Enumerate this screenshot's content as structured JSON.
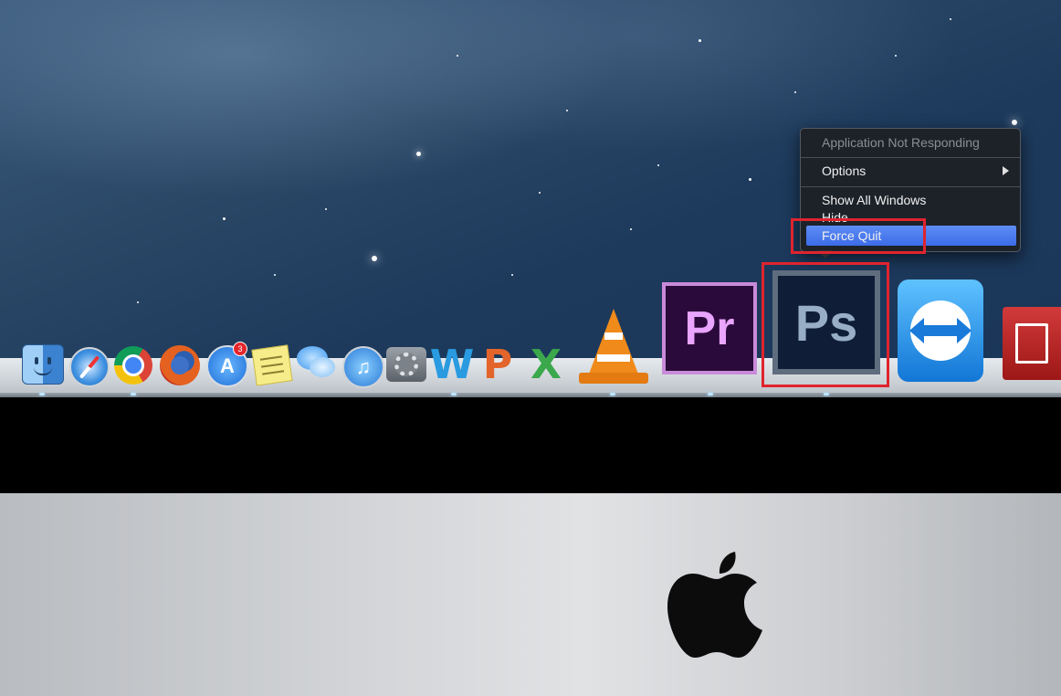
{
  "context_menu": {
    "header": "Application Not Responding",
    "items": [
      {
        "label": "Options",
        "has_submenu": true
      },
      {
        "label": "Show All Windows"
      },
      {
        "label": "Hide"
      },
      {
        "label": "Force Quit",
        "highlighted": true
      }
    ]
  },
  "dock": {
    "apps": [
      {
        "name": "Finder",
        "icon": "finder-icon"
      },
      {
        "name": "Safari",
        "icon": "safari-icon"
      },
      {
        "name": "Google Chrome",
        "icon": "chrome-icon"
      },
      {
        "name": "Firefox",
        "icon": "firefox-icon"
      },
      {
        "name": "App Store",
        "icon": "app-store-icon",
        "badge": "3"
      },
      {
        "name": "Stickies",
        "icon": "stickies-icon"
      },
      {
        "name": "Messages",
        "icon": "messages-icon"
      },
      {
        "name": "iTunes",
        "icon": "itunes-icon"
      },
      {
        "name": "System Preferences",
        "icon": "system-preferences-icon"
      },
      {
        "name": "Word",
        "icon": "word-icon",
        "glyph": "W"
      },
      {
        "name": "PowerPoint",
        "icon": "powerpoint-icon",
        "glyph": "P"
      },
      {
        "name": "Excel",
        "icon": "excel-icon",
        "glyph": "X"
      },
      {
        "name": "VLC",
        "icon": "vlc-icon"
      },
      {
        "name": "Adobe Premiere",
        "icon": "premiere-icon",
        "glyph": "Pr"
      },
      {
        "name": "Adobe Photoshop",
        "icon": "photoshop-icon",
        "glyph": "Ps"
      },
      {
        "name": "TeamViewer",
        "icon": "teamviewer-icon"
      },
      {
        "name": "Adobe Acrobat",
        "icon": "acrobat-icon"
      }
    ]
  },
  "itunes_glyph": "♫",
  "appstore_glyph": "A",
  "colors": {
    "menu_highlight": "#4a7cf0",
    "annotation_box": "#e0242e"
  }
}
